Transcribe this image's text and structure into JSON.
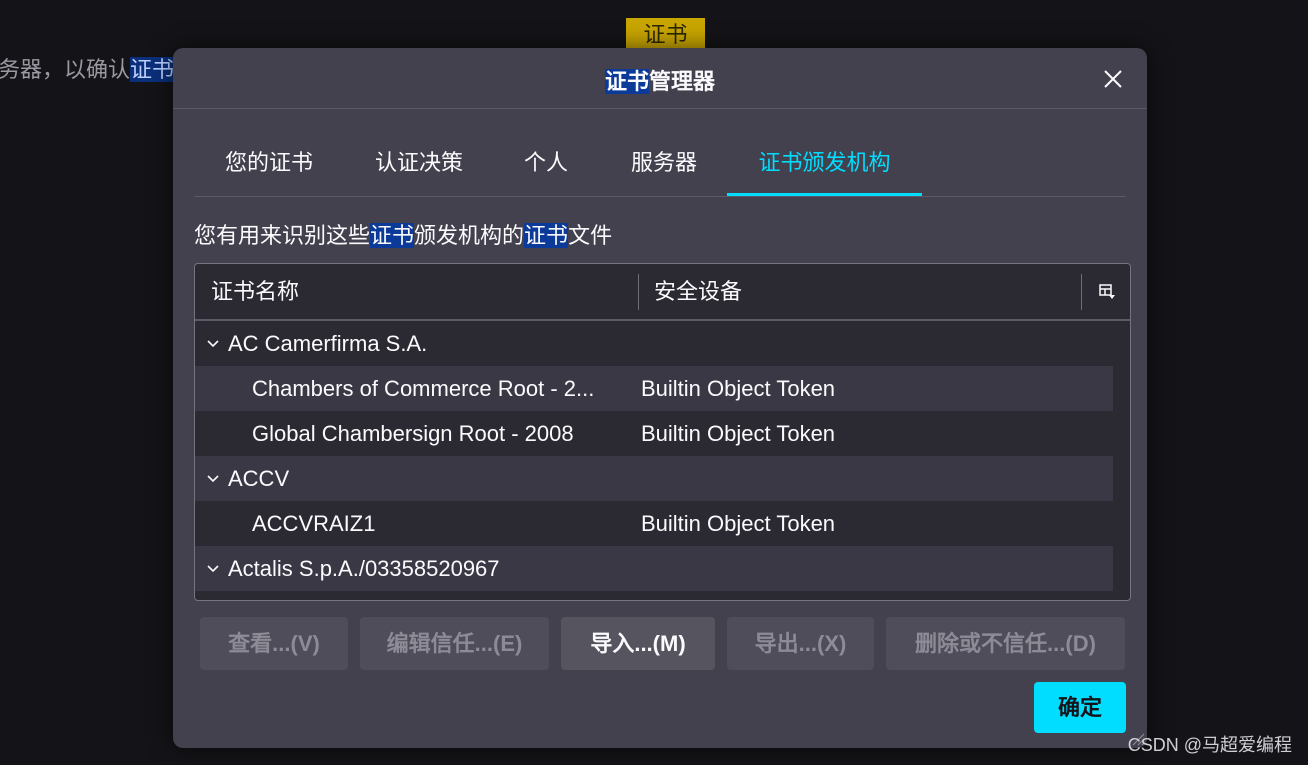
{
  "background": {
    "text_before": "务器，以确认",
    "text_highlight": "证书",
    "badge": "证书",
    "watermark": "CSDN @马超爱编程"
  },
  "dialog": {
    "title_highlight": "证书",
    "title_rest": "管理器",
    "tabs": [
      {
        "label": "您的证书",
        "active": false
      },
      {
        "label": "认证决策",
        "active": false
      },
      {
        "label": "个人",
        "active": false
      },
      {
        "label": "服务器",
        "active": false
      },
      {
        "label": "证书颁发机构",
        "active": true
      }
    ],
    "description": {
      "part1": "您有用来识别这些",
      "hl1": "证书",
      "part2": "颁发机构的",
      "hl2": "证书",
      "part3": "文件"
    },
    "table": {
      "columns": [
        "证书名称",
        "安全设备"
      ],
      "rows": [
        {
          "type": "group",
          "name": "AC Camerfirma S.A.",
          "token": "",
          "expanded": true
        },
        {
          "type": "item",
          "name": "Chambers of Commerce Root - 2...",
          "token": "Builtin Object Token"
        },
        {
          "type": "item",
          "name": "Global Chambersign Root - 2008",
          "token": "Builtin Object Token"
        },
        {
          "type": "group",
          "name": "ACCV",
          "token": "",
          "expanded": true
        },
        {
          "type": "item",
          "name": "ACCVRAIZ1",
          "token": "Builtin Object Token"
        },
        {
          "type": "group",
          "name": "Actalis S.p.A./03358520967",
          "token": "",
          "expanded": true
        }
      ]
    },
    "buttons": {
      "view": "查看...(V)",
      "edit_trust": "编辑信任...(E)",
      "import": "导入...(M)",
      "export": "导出...(X)",
      "delete": "删除或不信任...(D)",
      "ok": "确定"
    },
    "colors": {
      "accent": "#00ddff",
      "dialog_bg": "#42414d",
      "tree_bg": "#2b2a33",
      "highlight": "#0b3a98"
    }
  }
}
